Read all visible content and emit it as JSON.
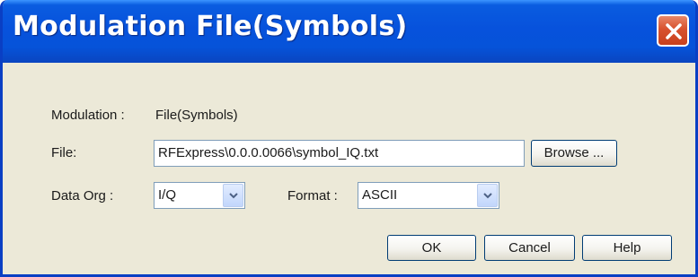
{
  "window": {
    "title": "Modulation File(Symbols)"
  },
  "form": {
    "modulation_label": "Modulation :",
    "modulation_value": "File(Symbols)",
    "file_label": "File:",
    "file_value": "RFExpress\\0.0.0.0066\\symbol_IQ.txt",
    "browse_label": "Browse ...",
    "data_org_label": "Data Org :",
    "data_org_value": "I/Q",
    "format_label": "Format :",
    "format_value": "ASCII"
  },
  "buttons": {
    "ok": "OK",
    "cancel": "Cancel",
    "help": "Help"
  },
  "colors": {
    "titlebar": "#0752dc",
    "close_button": "#d8522f",
    "dialog_background": "#ece9d8"
  },
  "icons": {
    "close": "close-icon",
    "dropdown": "chevron-down-icon"
  }
}
